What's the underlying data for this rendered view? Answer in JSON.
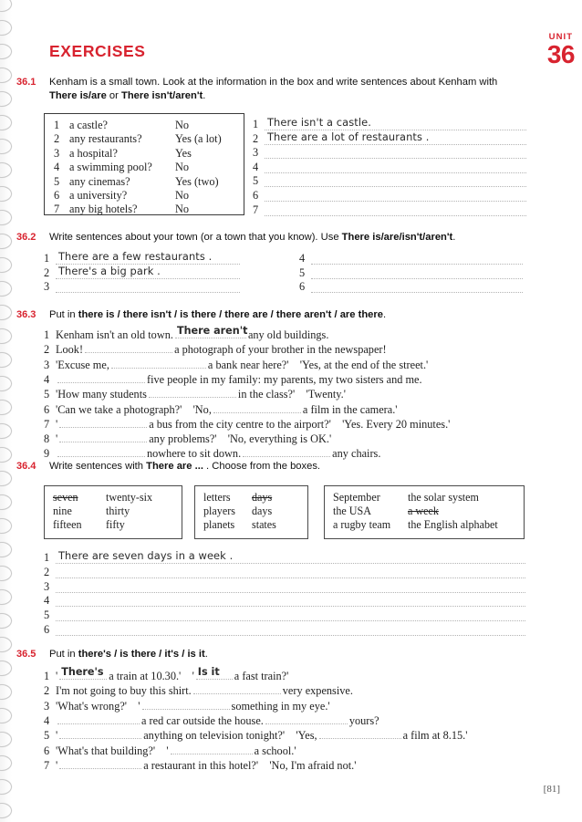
{
  "header": {
    "exercises_title": "EXERCISES",
    "unit_word": "UNIT",
    "unit_number": "36",
    "accent_color": "#d8232f"
  },
  "footer": {
    "page_number": "[81]"
  },
  "exercises": [
    {
      "number": "36.1",
      "instruction_line1": "Kenham is a small town. Look at the information in the box and write sentences about Kenham with",
      "instruction_line2_pre": "",
      "instruction_bold_a": "There is/are",
      "instruction_mid": " or ",
      "instruction_bold_b": "There isn't/aren't",
      "instruction_end": ".",
      "info_box": {
        "rows": [
          {
            "n": "1",
            "question": "a castle?",
            "answer": "No"
          },
          {
            "n": "2",
            "question": "any restaurants?",
            "answer": "Yes (a lot)"
          },
          {
            "n": "3",
            "question": "a hospital?",
            "answer": "Yes"
          },
          {
            "n": "4",
            "question": "a swimming pool?",
            "answer": "No"
          },
          {
            "n": "5",
            "question": "any cinemas?",
            "answer": "Yes (two)"
          },
          {
            "n": "6",
            "question": "a university?",
            "answer": "No"
          },
          {
            "n": "7",
            "question": "any big hotels?",
            "answer": "No"
          }
        ]
      },
      "answers": [
        {
          "n": "1",
          "handwritten": "There isn't a castle."
        },
        {
          "n": "2",
          "handwritten": "There are a lot of restaurants ."
        },
        {
          "n": "3",
          "handwritten": ""
        },
        {
          "n": "4",
          "handwritten": ""
        },
        {
          "n": "5",
          "handwritten": ""
        },
        {
          "n": "6",
          "handwritten": ""
        },
        {
          "n": "7",
          "handwritten": ""
        }
      ]
    },
    {
      "number": "36.2",
      "instruction_pre": "Write sentences about your town (or a town that you know). Use ",
      "instruction_bold": "There is/are/isn't/aren't",
      "instruction_end": ".",
      "answers_left": [
        {
          "n": "1",
          "handwritten": "There are a few restaurants ."
        },
        {
          "n": "2",
          "handwritten": "There's a big park ."
        },
        {
          "n": "3",
          "handwritten": ""
        }
      ],
      "answers_right": [
        {
          "n": "4",
          "handwritten": ""
        },
        {
          "n": "5",
          "handwritten": ""
        },
        {
          "n": "6",
          "handwritten": ""
        }
      ]
    },
    {
      "number": "36.3",
      "instruction_pre": "Put in ",
      "instruction_bold": "there is / there isn't / is there / there are / there aren't / are there",
      "instruction_end": ".",
      "items": [
        {
          "n": "1",
          "before": "Kenham isn't an old town.",
          "gap_text": "There aren't",
          "gap_w": 78,
          "after": "any old buildings."
        },
        {
          "n": "2",
          "before": "Look!",
          "gap_text": "",
          "gap_w": 96,
          "after": "a photograph of your brother in the newspaper!"
        },
        {
          "n": "3",
          "before": "'Excuse me,",
          "gap_text": "",
          "gap_w": 104,
          "after": "a bank near here?'    'Yes, at the end of the street.'"
        },
        {
          "n": "4",
          "before": "",
          "gap_text": "",
          "gap_w": 96,
          "after": "five people in my family: my parents, my two sisters and me."
        },
        {
          "n": "5",
          "before": "'How many students",
          "gap_text": "",
          "gap_w": 96,
          "after": "in the class?'    'Twenty.'"
        },
        {
          "n": "6",
          "before": "'Can we take a photograph?'    'No,",
          "gap_text": "",
          "gap_w": 96,
          "after": "a film in the camera.'"
        },
        {
          "n": "7",
          "before": "'",
          "gap_text": "",
          "gap_w": 96,
          "after": "a bus from the city centre to the airport?'    'Yes. Every 20 minutes.'"
        },
        {
          "n": "8",
          "before": "'",
          "gap_text": "",
          "gap_w": 96,
          "after": "any problems?'    'No, everything is OK.'"
        },
        {
          "n": "9",
          "before": "",
          "gap_text": "",
          "gap_w": 96,
          "after": "nowhere to sit down.",
          "gap2_w": 96,
          "after2": "any chairs."
        }
      ]
    },
    {
      "number": "36.4",
      "instruction_pre": "Write sentences with ",
      "instruction_bold": "There are ...",
      "instruction_end": " .  Choose from the boxes.",
      "boxes": [
        {
          "col1": [
            {
              "t": "seven",
              "struck": true
            },
            {
              "t": "nine",
              "struck": false
            },
            {
              "t": "fifteen",
              "struck": false
            }
          ],
          "col2": [
            {
              "t": "twenty-six",
              "struck": false
            },
            {
              "t": "thirty",
              "struck": false
            },
            {
              "t": "fifty",
              "struck": false
            }
          ]
        },
        {
          "col1": [
            {
              "t": "letters",
              "struck": false
            },
            {
              "t": "players",
              "struck": false
            },
            {
              "t": "planets",
              "struck": false
            }
          ],
          "col2": [
            {
              "t": "days",
              "struck": true
            },
            {
              "t": "days",
              "struck": false
            },
            {
              "t": "states",
              "struck": false
            }
          ]
        },
        {
          "col1": [
            {
              "t": "September",
              "struck": false
            },
            {
              "t": "the USA",
              "struck": false
            },
            {
              "t": "a rugby team",
              "struck": false
            }
          ],
          "col2": [
            {
              "t": "the solar system",
              "struck": false
            },
            {
              "t": "a week",
              "struck": true
            },
            {
              "t": "the English alphabet",
              "struck": false
            }
          ]
        }
      ],
      "answers": [
        {
          "n": "1",
          "handwritten": "There are seven days in a week ."
        },
        {
          "n": "2",
          "handwritten": ""
        },
        {
          "n": "3",
          "handwritten": ""
        },
        {
          "n": "4",
          "handwritten": ""
        },
        {
          "n": "5",
          "handwritten": ""
        },
        {
          "n": "6",
          "handwritten": ""
        }
      ]
    },
    {
      "number": "36.5",
      "instruction_pre": "Put in ",
      "instruction_bold": "there's / is there / it's / is it",
      "instruction_end": ".",
      "items": [
        {
          "n": "1",
          "before": "'",
          "gap_text": "There's",
          "gap_w": 52,
          "after": "a train at 10.30.'    '",
          "gap2_text": "Is it",
          "gap2_w": 40,
          "after2": "a fast train?'"
        },
        {
          "n": "2",
          "before": "I'm not going to buy this shirt.",
          "gap_text": "",
          "gap_w": 96,
          "after": "very expensive."
        },
        {
          "n": "3",
          "before": "'What's wrong?'    '",
          "gap_text": "",
          "gap_w": 96,
          "after": "something in my eye.'"
        },
        {
          "n": "4",
          "before": "",
          "gap_text": "",
          "gap_w": 90,
          "after": "a red car outside the house.",
          "gap2_text": "",
          "gap2_w": 90,
          "after2": "yours?"
        },
        {
          "n": "5",
          "before": "'",
          "gap_text": "",
          "gap_w": 90,
          "after": "anything on television tonight?'    'Yes,",
          "gap2_text": "",
          "gap2_w": 90,
          "after2": "a film at 8.15.'"
        },
        {
          "n": "6",
          "before": "'What's that building?'    '",
          "gap_text": "",
          "gap_w": 90,
          "after": "a school.'"
        },
        {
          "n": "7",
          "before": "'",
          "gap_text": "",
          "gap_w": 90,
          "after": "a restaurant in this hotel?'    'No, I'm afraid not.'"
        }
      ]
    }
  ]
}
